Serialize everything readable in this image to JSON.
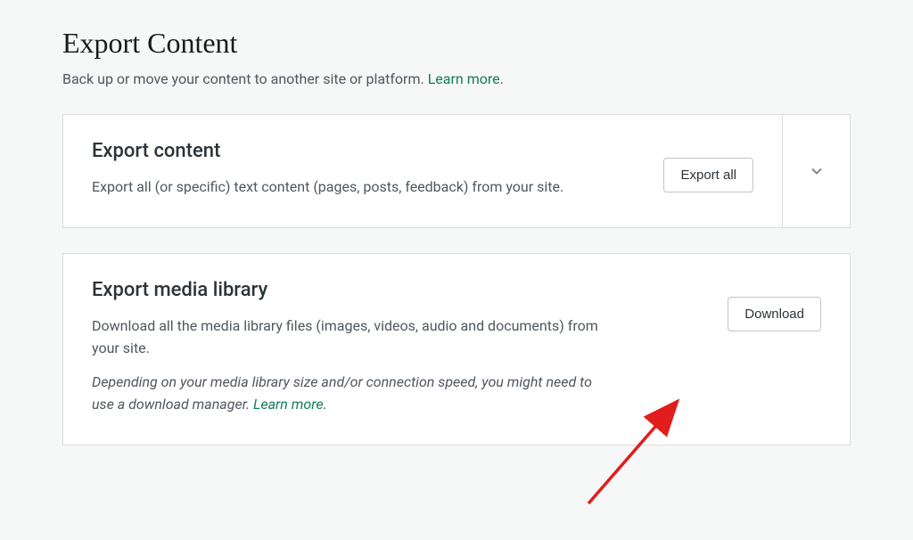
{
  "page": {
    "title": "Export Content",
    "subtitle": "Back up or move your content to another site or platform. ",
    "learn_more": "Learn more"
  },
  "cards": {
    "export_content": {
      "title": "Export content",
      "desc": "Export all (or specific) text content (pages, posts, feedback) from your site.",
      "button": "Export all"
    },
    "export_media": {
      "title": "Export media library",
      "desc": "Download all the media library files (images, videos, audio and documents) from your site.",
      "note_prefix": "Depending on your media library size and/or connection speed, you might need to use a download manager. ",
      "note_link": "Learn more",
      "button": "Download"
    }
  }
}
